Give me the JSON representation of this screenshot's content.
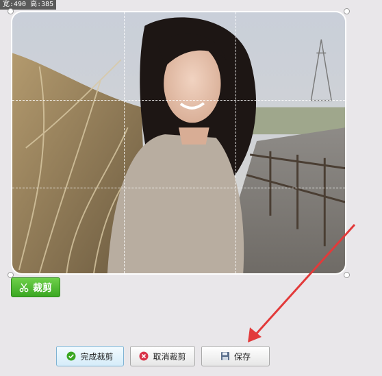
{
  "crop_info": {
    "dimensions_label": "宽:490 高:385"
  },
  "toolbar": {
    "crop_label": "裁剪",
    "complete_crop_label": "完成裁剪",
    "cancel_crop_label": "取消裁剪",
    "save_label": "保存"
  },
  "icons": {
    "crop": "scissors-icon",
    "complete": "check-circle-icon",
    "cancel": "x-circle-icon",
    "save": "floppy-disk-icon"
  },
  "colors": {
    "crop_button": "#3aa722",
    "arrow": "#e23a3a"
  }
}
